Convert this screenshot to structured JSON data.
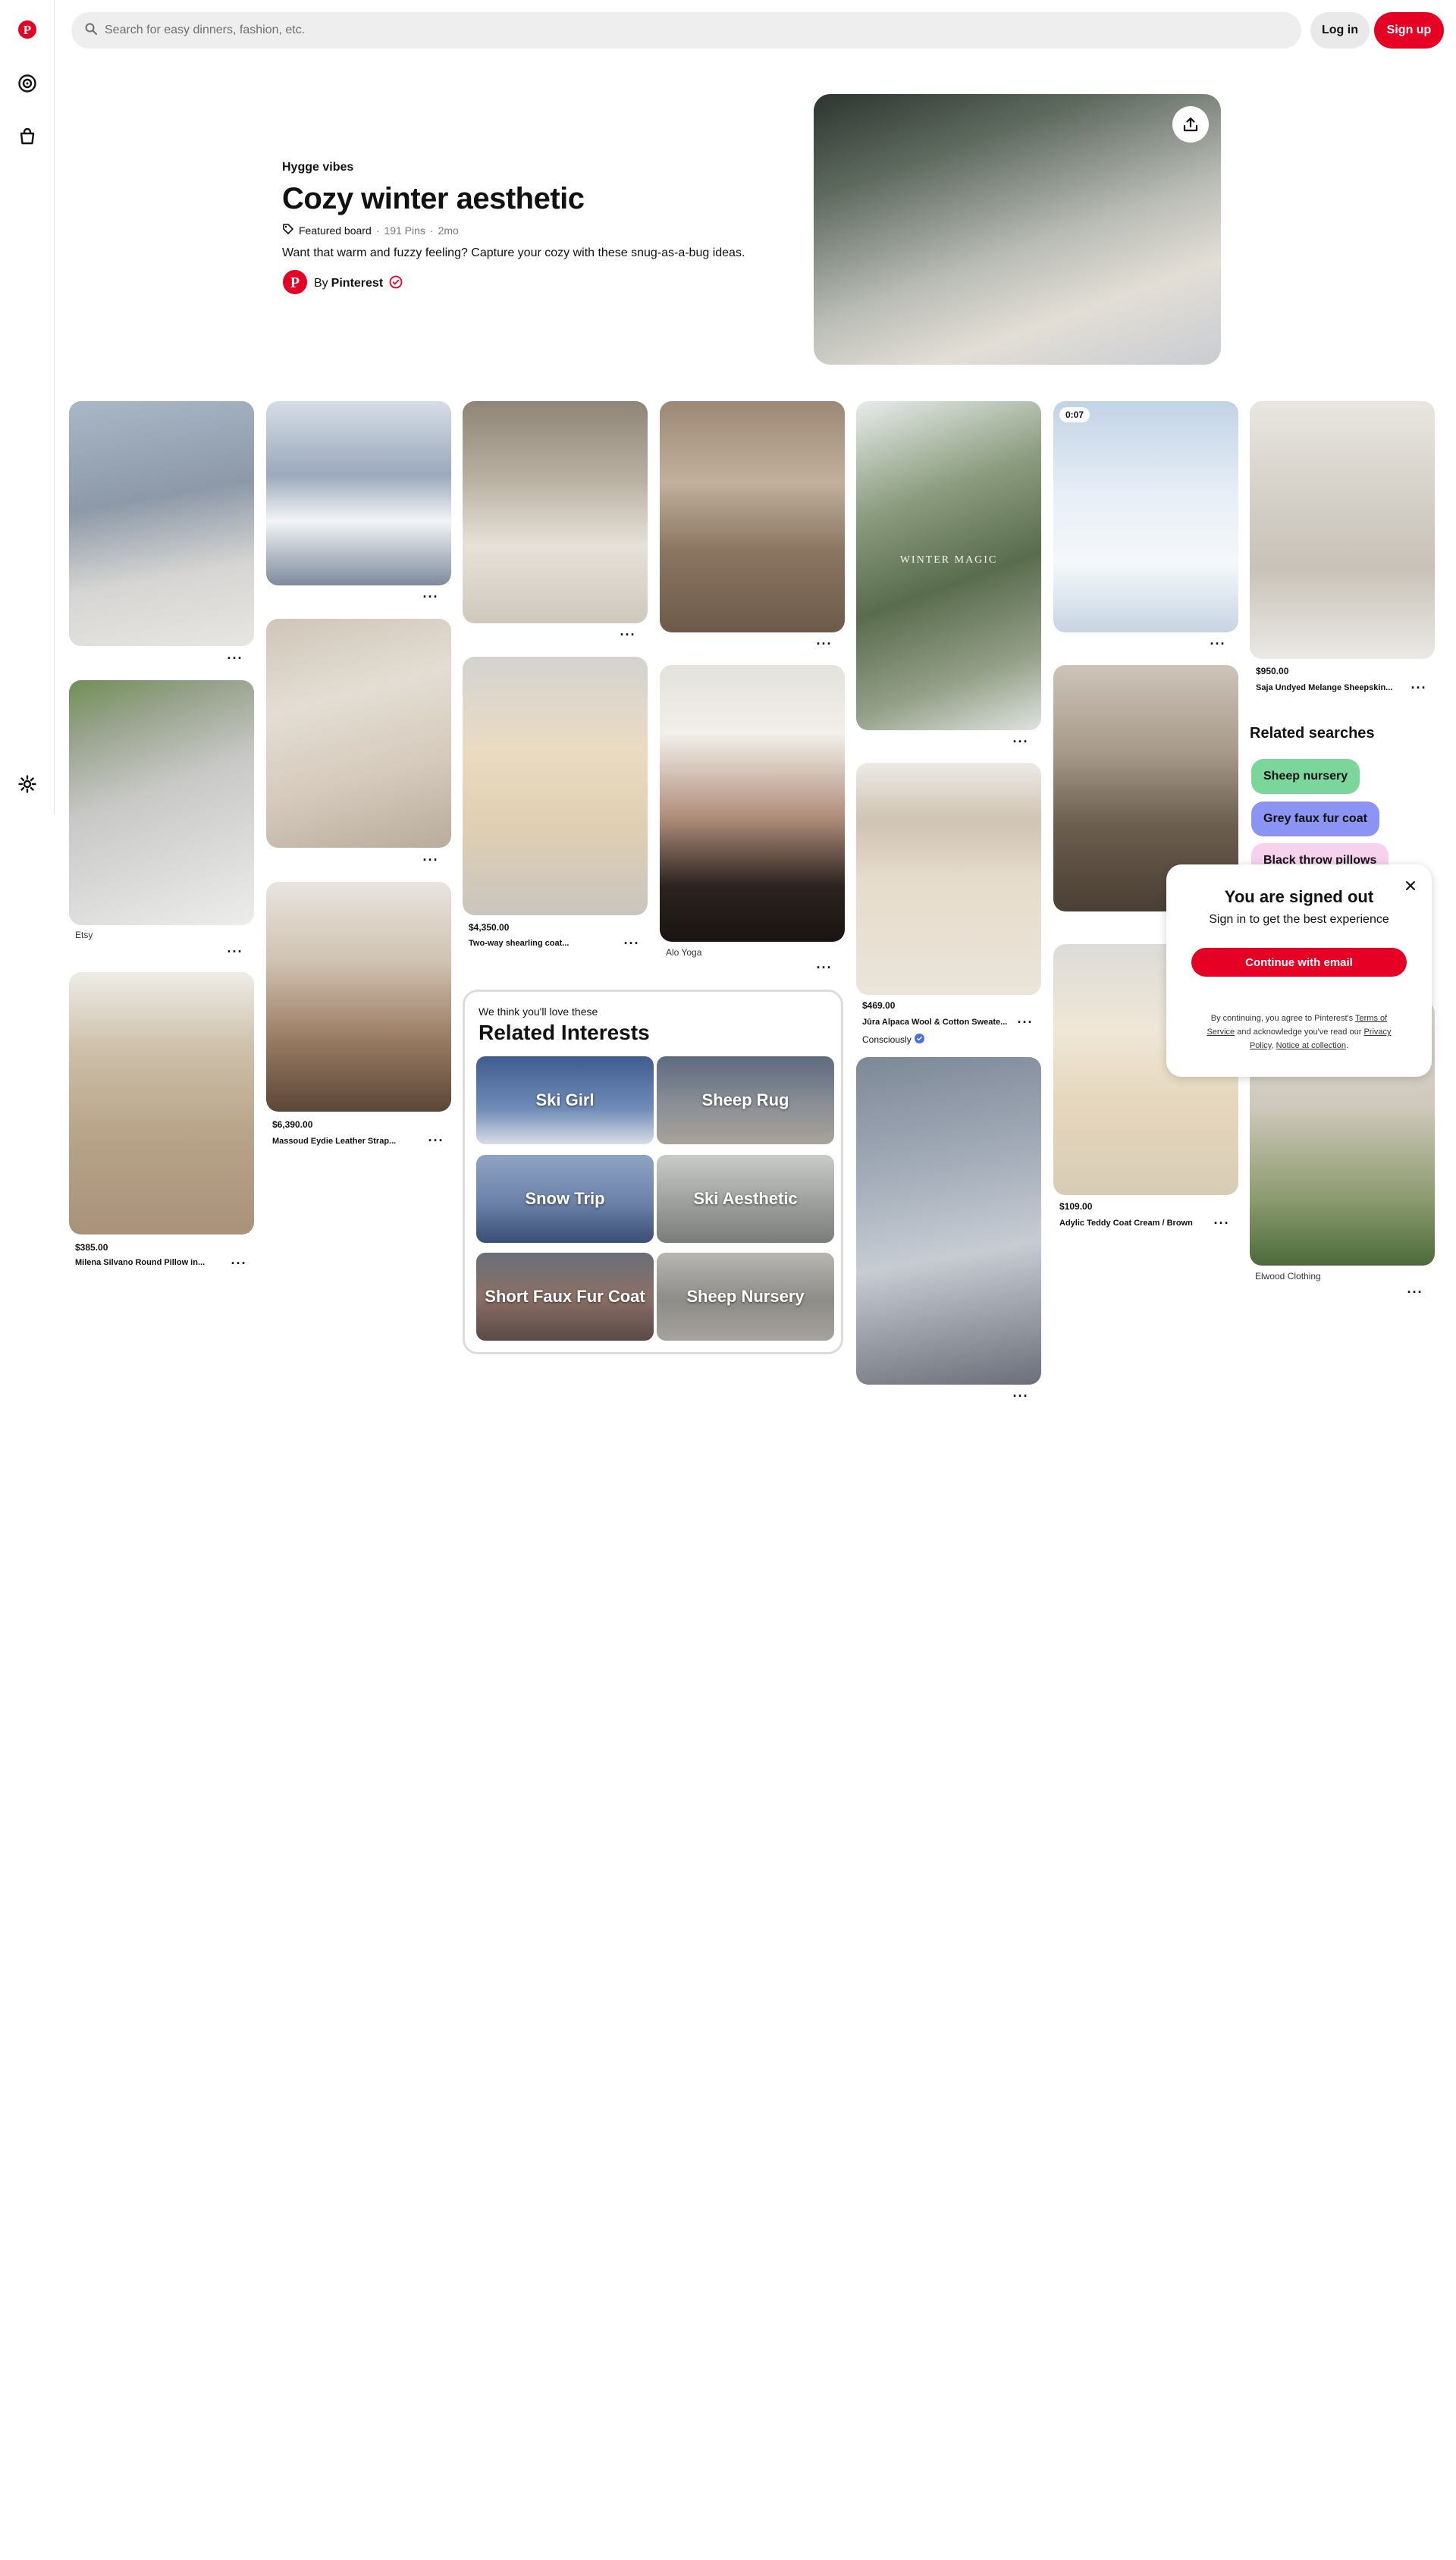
{
  "colors": {
    "brand": "#e60023",
    "chip_green": "#7bd69c",
    "chip_blue": "#8b93f3",
    "chip_pink": "#f6d2ef"
  },
  "search": {
    "placeholder": "Search for easy dinners, fashion, etc."
  },
  "header": {
    "login_label": "Log in",
    "signup_label": "Sign up"
  },
  "board": {
    "kicker": "Hygge vibes",
    "title": "Cozy winter aesthetic",
    "featured_label": "Featured board",
    "pins_count": "191 Pins",
    "age": "2mo",
    "separator": "·",
    "description": "Want that warm and fuzzy feeling? Capture your cozy with these snug-as-a-bug ideas.",
    "by_label": "By",
    "author": "Pinterest"
  },
  "pins": {
    "etsy_source": "Etsy",
    "pillow_price": "$385.00",
    "pillow_title": "Milena Silvano Round Pillow in...",
    "chair_price": "$6,390.00",
    "chair_title": "Massoud Eydie Leather Strap...",
    "coat_price": "$4,350.00",
    "coat_title": "Two-way shearling coat...",
    "aloyoga_source": "Alo Yoga",
    "sweater_price": "$469.00",
    "sweater_title": "Jūra Alpaca Wool & Cotton Sweate...",
    "sweater_source": "Consciously",
    "video_duration": "0:07",
    "teddy_price": "$109.00",
    "teddy_title": "Adylic Teddy Coat Cream / Brown",
    "sheepskin_price": "$950.00",
    "sheepskin_title": "Saja Undyed Melange Sheepskin...",
    "elwood_source": "Elwood Clothing",
    "winter_magic_text": "WINTER MAGIC"
  },
  "related_interests": {
    "subtitle": "We think you'll love these",
    "title": "Related Interests",
    "items": [
      "Ski Girl",
      "Sheep Rug",
      "Snow Trip",
      "Ski Aesthetic",
      "Short Faux Fur Coat",
      "Sheep Nursery"
    ]
  },
  "related_searches": {
    "title": "Related searches",
    "items": [
      "Sheep nursery",
      "Grey faux fur coat",
      "Black throw pillows"
    ]
  },
  "modal": {
    "title": "You are signed out",
    "subtitle": "Sign in to get the best experience",
    "cta": "Continue with email",
    "legal_prefix": "By continuing, you agree to Pinterest's",
    "terms": "Terms of Service",
    "legal_middle": "and acknowledge you've read our",
    "privacy": "Privacy Policy",
    "notice": "Notice at collection",
    "legal_end": "."
  },
  "icons": {
    "logo": "pinterest-logo-icon",
    "explore": "compass-icon",
    "shop": "shopping-bag-icon",
    "settings": "gear-icon",
    "search": "search-icon",
    "share": "share-icon",
    "verified": "verified-badge-icon",
    "close": "close-icon",
    "more": "more-options-icon"
  }
}
